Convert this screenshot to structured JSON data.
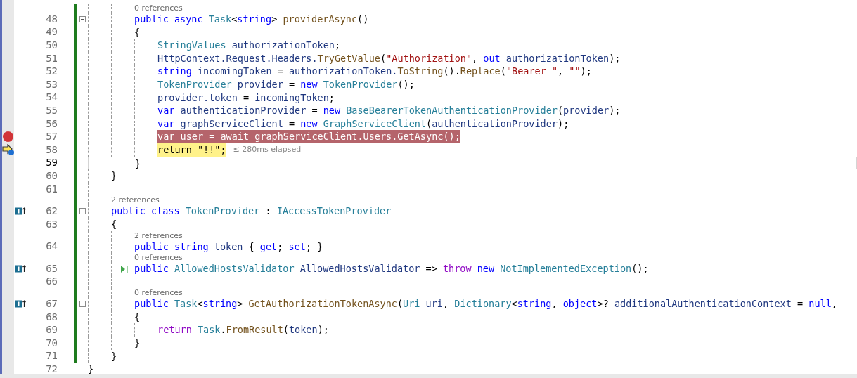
{
  "editor": {
    "lines": [
      {
        "children": [
          {
            "children": [
              {
                "number": "48",
                "references": "0 references",
                "fold": true,
                "modified": true,
                "tokens": [
                  {
                    "kind": "kw",
                    "text": "public"
                  },
                  {
                    "kind": "kw",
                    "text": " async"
                  },
                  {
                    "kind": "type",
                    "text": " Task"
                  },
                  {
                    "kind": "plain",
                    "text": "<"
                  },
                  {
                    "kind": "kw",
                    "text": "string"
                  },
                  {
                    "kind": "plain",
                    "text": ">"
                  },
                  {
                    "kind": "fn",
                    "text": " providerAsync"
                  },
                  {
                    "kind": "plain",
                    "text": "()"
                  }
                ]
              },
              {
                "number": "49",
                "modified": true,
                "tokens": [
                  {
                    "kind": "plain",
                    "text": "{"
                  }
                ],
                "children": [
                  {
                    "number": "50",
                    "modified": true,
                    "tokens": [
                      {
                        "kind": "type",
                        "text": "StringValues"
                      },
                      {
                        "kind": "id",
                        "text": " authorizationToken"
                      },
                      {
                        "kind": "plain",
                        "text": ";"
                      }
                    ]
                  },
                  {
                    "number": "51",
                    "modified": true,
                    "tokens": [
                      {
                        "kind": "id",
                        "text": "HttpContext.Request.Headers."
                      },
                      {
                        "kind": "fn",
                        "text": "TryGetValue"
                      },
                      {
                        "kind": "plain",
                        "text": "("
                      },
                      {
                        "kind": "str",
                        "text": "\"Authorization\""
                      },
                      {
                        "kind": "plain",
                        "text": ","
                      },
                      {
                        "kind": "kw",
                        "text": " out"
                      },
                      {
                        "kind": "id",
                        "text": " authorizationToken"
                      },
                      {
                        "kind": "plain",
                        "text": ");"
                      }
                    ]
                  },
                  {
                    "number": "52",
                    "modified": true,
                    "tokens": [
                      {
                        "kind": "kw",
                        "text": "string"
                      },
                      {
                        "kind": "id",
                        "text": " incomingToken"
                      },
                      {
                        "kind": "plain",
                        "text": " = "
                      },
                      {
                        "kind": "id",
                        "text": "authorizationToken."
                      },
                      {
                        "kind": "fn",
                        "text": "ToString"
                      },
                      {
                        "kind": "plain",
                        "text": "()."
                      },
                      {
                        "kind": "fn",
                        "text": "Replace"
                      },
                      {
                        "kind": "plain",
                        "text": "("
                      },
                      {
                        "kind": "str",
                        "text": "\"Bearer \""
                      },
                      {
                        "kind": "plain",
                        "text": ","
                      },
                      {
                        "kind": "str",
                        "text": " \"\""
                      },
                      {
                        "kind": "plain",
                        "text": ");"
                      }
                    ]
                  },
                  {
                    "number": "53",
                    "modified": true,
                    "tokens": [
                      {
                        "kind": "type",
                        "text": "TokenProvider"
                      },
                      {
                        "kind": "id",
                        "text": " provider"
                      },
                      {
                        "kind": "plain",
                        "text": " = "
                      },
                      {
                        "kind": "kw",
                        "text": "new"
                      },
                      {
                        "kind": "type",
                        "text": " TokenProvider"
                      },
                      {
                        "kind": "plain",
                        "text": "();"
                      }
                    ]
                  },
                  {
                    "number": "54",
                    "modified": true,
                    "tokens": [
                      {
                        "kind": "id",
                        "text": "provider.token"
                      },
                      {
                        "kind": "plain",
                        "text": " = "
                      },
                      {
                        "kind": "id",
                        "text": "incomingToken"
                      },
                      {
                        "kind": "plain",
                        "text": ";"
                      }
                    ]
                  },
                  {
                    "number": "55",
                    "modified": true,
                    "tokens": [
                      {
                        "kind": "kw",
                        "text": "var"
                      },
                      {
                        "kind": "id",
                        "text": " authenticationProvider"
                      },
                      {
                        "kind": "plain",
                        "text": " = "
                      },
                      {
                        "kind": "kw",
                        "text": "new"
                      },
                      {
                        "kind": "type",
                        "text": " BaseBearerTokenAuthenticationProvider"
                      },
                      {
                        "kind": "plain",
                        "text": "("
                      },
                      {
                        "kind": "id",
                        "text": "provider"
                      },
                      {
                        "kind": "plain",
                        "text": ");"
                      }
                    ]
                  },
                  {
                    "number": "56",
                    "modified": true,
                    "tokens": [
                      {
                        "kind": "kw",
                        "text": "var"
                      },
                      {
                        "kind": "id",
                        "text": " graphServiceClient"
                      },
                      {
                        "kind": "plain",
                        "text": " = "
                      },
                      {
                        "kind": "kw",
                        "text": "new"
                      },
                      {
                        "kind": "type",
                        "text": " GraphServiceClient"
                      },
                      {
                        "kind": "plain",
                        "text": "("
                      },
                      {
                        "kind": "id",
                        "text": "authenticationProvider"
                      },
                      {
                        "kind": "plain",
                        "text": ");"
                      }
                    ]
                  },
                  {
                    "number": "57",
                    "modified": true,
                    "breakpoint": true,
                    "tokens": [
                      {
                        "text": "var user = await graphServiceClient.Users.GetAsync();"
                      }
                    ]
                  },
                  {
                    "number": "58",
                    "modified": true,
                    "next_statement": true,
                    "hint": "≤ 280ms elapsed",
                    "tokens": [
                      {
                        "kind": "plain",
                        "text": "return \"!!\";"
                      }
                    ]
                  }
                ]
              },
              {
                "number": "59",
                "modified": true,
                "current": true,
                "tokens": [
                  {
                    "kind": "plain",
                    "text": "}"
                  }
                ]
              }
            ]
          },
          {
            "number": "60",
            "modified": true,
            "tokens": [
              {
                "kind": "plain",
                "text": "}"
              }
            ]
          },
          {
            "number": "61",
            "modified": true
          },
          {
            "number": "62",
            "references": "2 references",
            "fold": true,
            "implements": true,
            "modified": true,
            "tokens": [
              {
                "kind": "kw",
                "text": "public"
              },
              {
                "kind": "kw",
                "text": " class"
              },
              {
                "kind": "type",
                "text": " TokenProvider"
              },
              {
                "kind": "plain",
                "text": " : "
              },
              {
                "kind": "type",
                "text": "IAccessTokenProvider"
              }
            ]
          },
          {
            "number": "63",
            "modified": true,
            "tokens": [
              {
                "kind": "plain",
                "text": "{"
              }
            ],
            "children": [
              {
                "number": "64",
                "references": "2 references",
                "modified": true,
                "tokens": [
                  {
                    "kind": "kw",
                    "text": "public"
                  },
                  {
                    "kind": "kw",
                    "text": " string"
                  },
                  {
                    "kind": "id",
                    "text": " token"
                  },
                  {
                    "kind": "plain",
                    "text": " { "
                  },
                  {
                    "kind": "kw",
                    "text": "get"
                  },
                  {
                    "kind": "plain",
                    "text": "; "
                  },
                  {
                    "kind": "kw",
                    "text": "set"
                  },
                  {
                    "kind": "plain",
                    "text": "; }"
                  }
                ]
              },
              {
                "number": "65",
                "references": "0 references",
                "implements": true,
                "run": true,
                "modified": true,
                "tokens": [
                  {
                    "kind": "kw",
                    "text": "public"
                  },
                  {
                    "kind": "type",
                    "text": " AllowedHostsValidator"
                  },
                  {
                    "kind": "id",
                    "text": " AllowedHostsValidator"
                  },
                  {
                    "kind": "plain",
                    "text": " => "
                  },
                  {
                    "kind": "ctl",
                    "text": "throw"
                  },
                  {
                    "kind": "kw",
                    "text": " new"
                  },
                  {
                    "kind": "type",
                    "text": " NotImplementedException"
                  },
                  {
                    "kind": "plain",
                    "text": "();"
                  }
                ]
              },
              {
                "number": "66",
                "modified": true
              },
              {
                "number": "67",
                "references": "0 references",
                "fold": true,
                "implements": true,
                "modified": true,
                "tokens": [
                  {
                    "kind": "kw",
                    "text": "public"
                  },
                  {
                    "kind": "type",
                    "text": " Task"
                  },
                  {
                    "kind": "plain",
                    "text": "<"
                  },
                  {
                    "kind": "kw",
                    "text": "string"
                  },
                  {
                    "kind": "plain",
                    "text": ">"
                  },
                  {
                    "kind": "fn",
                    "text": " GetAuthorizationTokenAsync"
                  },
                  {
                    "kind": "plain",
                    "text": "("
                  },
                  {
                    "kind": "type",
                    "text": "Uri"
                  },
                  {
                    "kind": "id",
                    "text": " uri"
                  },
                  {
                    "kind": "plain",
                    "text": ","
                  },
                  {
                    "kind": "type",
                    "text": " Dictionary"
                  },
                  {
                    "kind": "plain",
                    "text": "<"
                  },
                  {
                    "kind": "kw",
                    "text": "string"
                  },
                  {
                    "kind": "plain",
                    "text": ","
                  },
                  {
                    "kind": "kw",
                    "text": " object"
                  },
                  {
                    "kind": "plain",
                    "text": ">?"
                  },
                  {
                    "kind": "id",
                    "text": " additionalAuthenticationContext"
                  },
                  {
                    "kind": "plain",
                    "text": " = "
                  },
                  {
                    "kind": "kw",
                    "text": "null"
                  },
                  {
                    "kind": "plain",
                    "text": ","
                  }
                ]
              },
              {
                "number": "68",
                "modified": true,
                "tokens": [
                  {
                    "kind": "plain",
                    "text": "{"
                  }
                ],
                "children": [
                  {
                    "number": "69",
                    "modified": true,
                    "tokens": [
                      {
                        "kind": "ctl",
                        "text": "return"
                      },
                      {
                        "kind": "type",
                        "text": " Task"
                      },
                      {
                        "kind": "plain",
                        "text": "."
                      },
                      {
                        "kind": "fn",
                        "text": "FromResult"
                      },
                      {
                        "kind": "plain",
                        "text": "("
                      },
                      {
                        "kind": "id",
                        "text": "token"
                      },
                      {
                        "kind": "plain",
                        "text": ");"
                      }
                    ]
                  }
                ]
              },
              {
                "number": "70",
                "modified": true,
                "tokens": [
                  {
                    "kind": "plain",
                    "text": "}"
                  }
                ]
              }
            ]
          },
          {
            "number": "71",
            "modified": true,
            "tokens": [
              {
                "kind": "plain",
                "text": "}"
              }
            ]
          }
        ]
      },
      {
        "number": "72",
        "modified": false,
        "tokens": [
          {
            "kind": "plain",
            "text": "}"
          }
        ]
      }
    ]
  }
}
